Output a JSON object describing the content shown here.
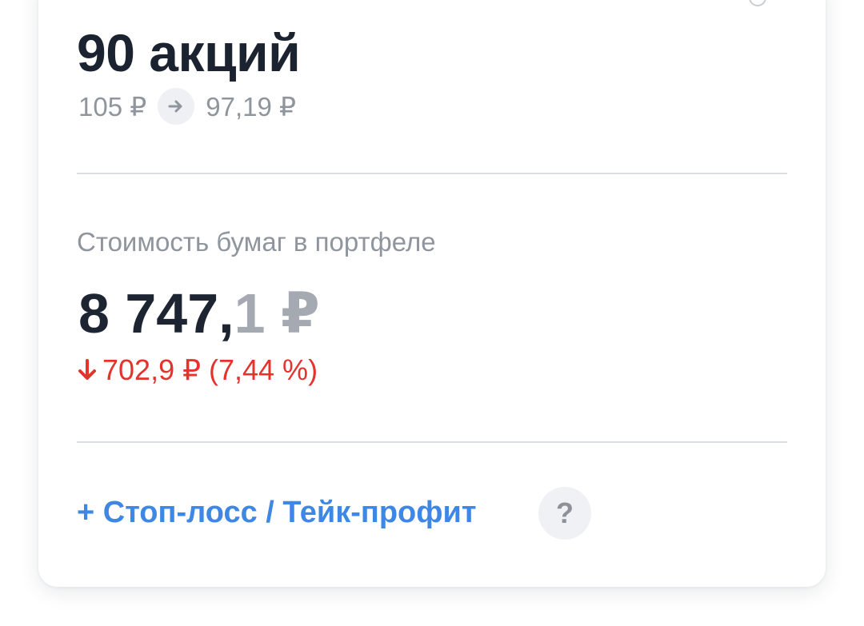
{
  "position": {
    "shares_text": "90 акций",
    "buy_price": "105 ₽",
    "current_price": "97,19 ₽"
  },
  "portfolio": {
    "label": "Стоимость бумаг в портфеле",
    "value_main": "8 747,",
    "value_fraction": "1 ₽",
    "change_text": "702,9 ₽ (7,44 %)"
  },
  "actions": {
    "stop_loss_label": "+ Стоп-лосс / Тейк-профит",
    "help_label": "?"
  },
  "colors": {
    "negative": "#e5322d",
    "link": "#3f87e4"
  },
  "icons": {
    "arrow": "arrow-right-icon",
    "change": "arrow-down-icon",
    "corner": "settings-icon"
  }
}
